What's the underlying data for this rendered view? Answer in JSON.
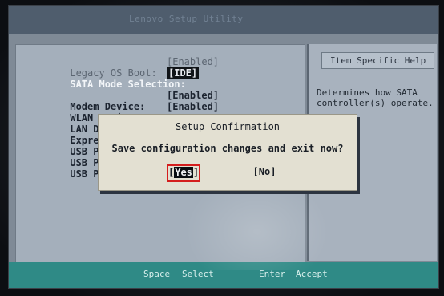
{
  "header": {
    "title": "Lenovo Setup Utility"
  },
  "settings": [
    {
      "label": "Legacy OS Boot:",
      "value": "[Enabled]",
      "style": "dim"
    },
    {
      "label": "SATA Mode Selection:",
      "value": "[IDE]",
      "style": "highlight"
    },
    {
      "label": "Modem Device:",
      "value": "[Enabled]",
      "style": "normal"
    },
    {
      "label": "WLAN Device:",
      "value": "[Enabled]",
      "style": "normal"
    },
    {
      "label": "LAN Device:",
      "value": "",
      "style": "normal"
    },
    {
      "label": "Express Card",
      "value": "",
      "style": "normal"
    },
    {
      "label": "USB Port Dev",
      "value": "",
      "style": "normal"
    },
    {
      "label": "USB Port Dev",
      "value": "",
      "style": "normal"
    },
    {
      "label": "USB Port Dev",
      "value": "",
      "style": "normal"
    }
  ],
  "help": {
    "title": "Item Specific Help",
    "text": "Determines how SATA\ncontroller(s) operate."
  },
  "dialog": {
    "title": "Setup Confirmation",
    "message": "Save configuration changes and exit now?",
    "yes_label": "Yes",
    "no_label": "[No]"
  },
  "footer": {
    "space_key": "Space",
    "space_action": "Select",
    "enter_key": "Enter",
    "enter_action": "Accept"
  },
  "colors": {
    "dialog_bg": "#e3e0d2",
    "highlight_border": "#d41d1d",
    "footer_bg": "#2f8a86"
  }
}
